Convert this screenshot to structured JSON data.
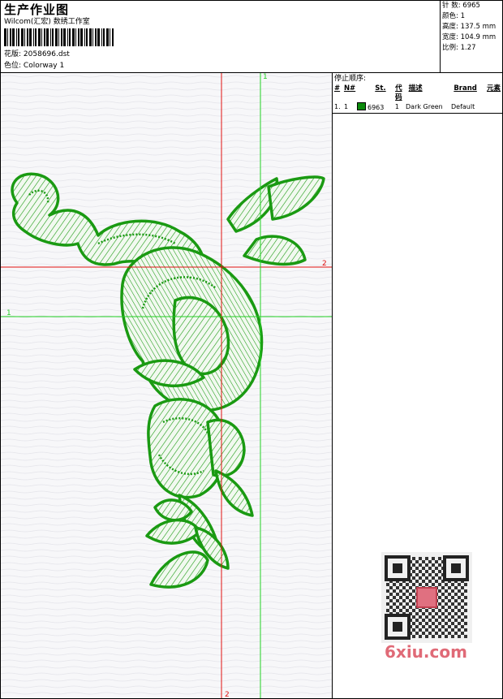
{
  "header": {
    "title": "生产作业图",
    "company": "Wilcom(汇宏) 数绣工作室",
    "design_label": "花版:",
    "design_value": "2058696.dst",
    "color_label": "色位:",
    "color_value": "Colorway 1"
  },
  "stats": [
    {
      "label": "针 数:",
      "value": "6965"
    },
    {
      "label": "颜色:",
      "value": "1"
    },
    {
      "label": "高度:",
      "value": "137.5 mm"
    },
    {
      "label": "宽度:",
      "value": "104.9 mm"
    },
    {
      "label": "比例:",
      "value": "1.27"
    }
  ],
  "panel": {
    "title": "停止顺序:",
    "columns": [
      "#",
      "N#",
      "St.",
      "代码",
      "描述",
      "Brand",
      "元素"
    ],
    "rows": [
      {
        "idx": "1.",
        "n": "1",
        "code": "6963",
        "st": "1",
        "desc": "Dark Green",
        "brand": "Default",
        "swatch": "#0b8a0b"
      }
    ]
  },
  "guides": {
    "red_h": "2",
    "red_v": "2",
    "green_h": "1",
    "green_v": "1"
  },
  "colors": {
    "thread": "#1a9a12",
    "red": "#e01010",
    "green": "#22d022"
  },
  "watermark": "6xiu.com"
}
